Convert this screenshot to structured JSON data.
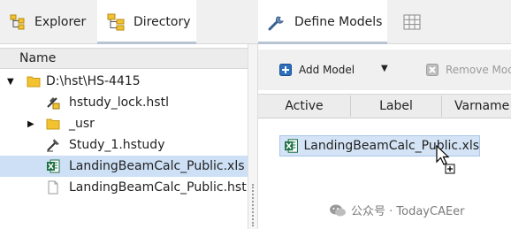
{
  "tabs": {
    "explorer": "Explorer",
    "directory": "Directory",
    "define_models": "Define Models"
  },
  "tree": {
    "column_header": "Name",
    "items": [
      {
        "label": "D:\\hst\\HS-4415",
        "icon": "folder-icon"
      },
      {
        "label": "hstudy_lock.hstl",
        "icon": "study-lock-icon"
      },
      {
        "label": "_usr",
        "icon": "folder-icon"
      },
      {
        "label": "Study_1.hstudy",
        "icon": "study-icon"
      },
      {
        "label": "LandingBeamCalc_Public.xls",
        "icon": "excel-file-icon",
        "selected": true
      },
      {
        "label": "LandingBeamCalc_Public.hstp",
        "icon": "file-icon"
      }
    ]
  },
  "toolbar": {
    "add_model": "Add Model",
    "remove_model": "Remove Mod"
  },
  "grid": {
    "columns": [
      "Active",
      "Label",
      "Varname"
    ]
  },
  "drag": {
    "item_label": "LandingBeamCalc_Public.xls"
  },
  "watermark": {
    "text": "公众号 · TodayCAEer"
  },
  "colors": {
    "selection": "#cde0f5",
    "excel_green": "#1e7145",
    "folder_yellow": "#f2c230",
    "add_blue": "#2c6fbf"
  }
}
